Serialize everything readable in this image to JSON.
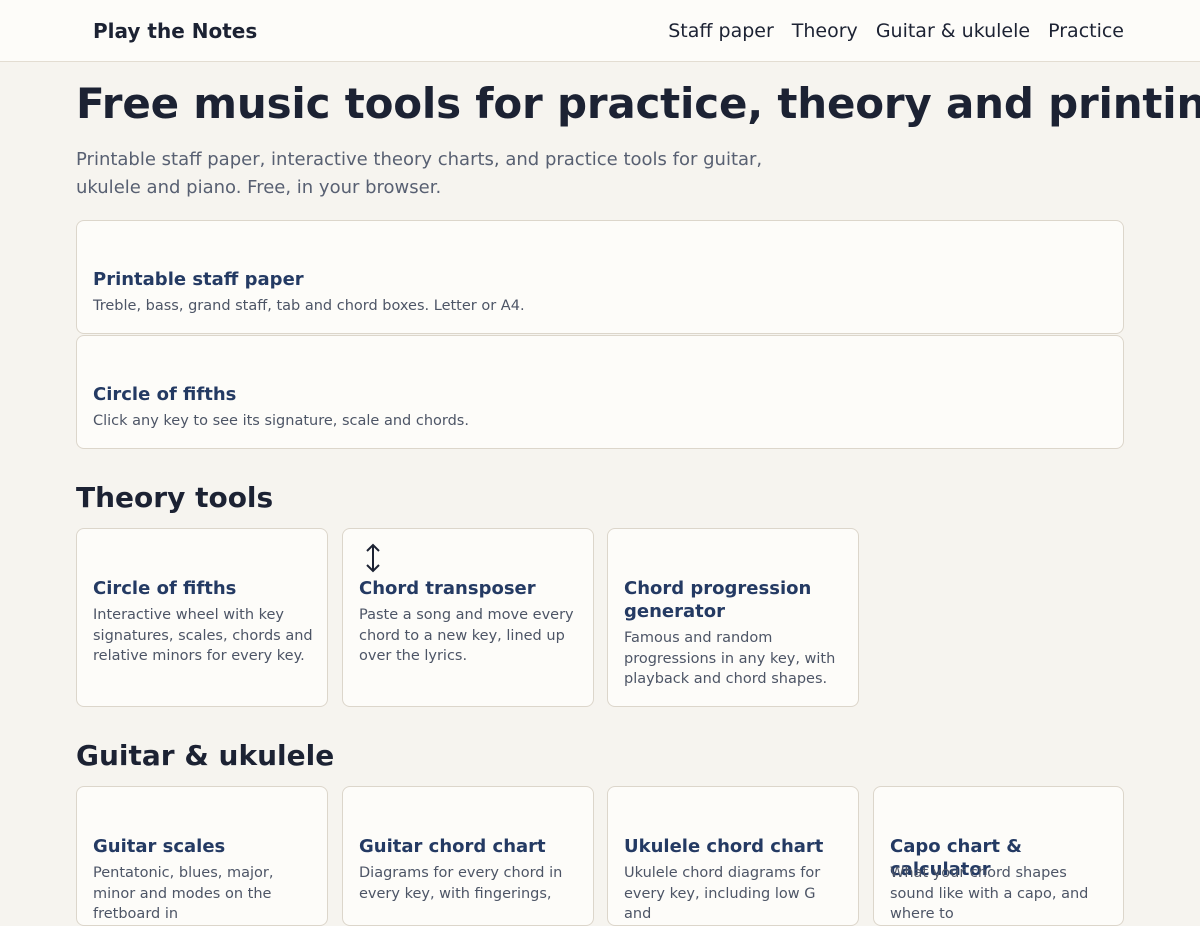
{
  "header": {
    "brand": "Play the Notes",
    "nav": [
      "Staff paper",
      "Theory",
      "Guitar & ukulele",
      "Practice"
    ]
  },
  "hero": {
    "title": "Free music tools for practice, theory and printing",
    "subtitle": "Printable staff paper, interactive theory charts, and practice tools for guitar, ukulele and piano. Free, in your browser."
  },
  "featured": [
    {
      "title": "Printable staff paper",
      "description": "Treble, bass, grand staff, tab and chord boxes. Letter or A4."
    },
    {
      "title": "Circle of fifths",
      "description": "Click any key to see its signature, scale and chords."
    }
  ],
  "sections": {
    "theory": {
      "title": "Theory tools",
      "cards": [
        {
          "title": "Circle of fifths",
          "description": "Interactive wheel with key signatures, scales, chords and relative minors for every key.",
          "icon": ""
        },
        {
          "title": "Chord transposer",
          "description": "Paste a song and move every chord to a new key, lined up over the lyrics.",
          "icon": "up-down-arrow-icon"
        },
        {
          "title": "Chord progression generator",
          "description": "Famous and random progressions in any key, with playback and chord shapes.",
          "icon": ""
        }
      ]
    },
    "guitar": {
      "title": "Guitar & ukulele",
      "cards": [
        {
          "title": "Guitar scales",
          "description": "Pentatonic, blues, major, minor and modes on the fretboard in"
        },
        {
          "title": "Guitar chord chart",
          "description": "Diagrams for every chord in every key, with fingerings,"
        },
        {
          "title": "Ukulele chord chart",
          "description": "Ukulele chord diagrams for every key, including low G and"
        },
        {
          "title": "Capo chart & calculator",
          "description": "What your chord shapes sound like with a capo, and where to"
        }
      ]
    }
  }
}
